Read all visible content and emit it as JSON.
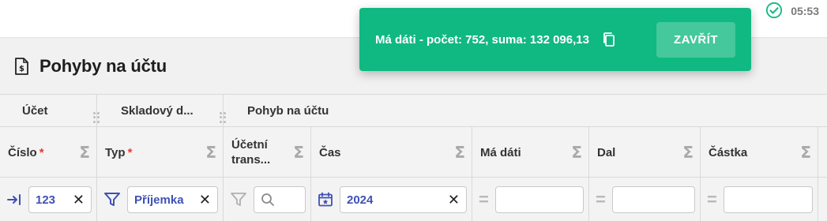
{
  "status": {
    "time": "05:53",
    "check_icon": "check-circle-icon",
    "color": "#10b981"
  },
  "page": {
    "title": "Pohyby na účtu",
    "icon": "document-dollar-icon"
  },
  "groups": [
    {
      "label": "Účet"
    },
    {
      "label": "Skladový d..."
    },
    {
      "label": "Pohyb na účtu"
    }
  ],
  "columns": {
    "cislo": {
      "label": "Číslo",
      "required": "*"
    },
    "typ": {
      "label": "Typ",
      "required": "*"
    },
    "ucetni_line1": "Účetní",
    "ucetni_line2": "trans...",
    "cas": {
      "label": "Čas"
    },
    "ma_dati": {
      "label": "Má dáti"
    },
    "dal": {
      "label": "Dal"
    },
    "castka": {
      "label": "Částka"
    },
    "sum_symbol": "Σ"
  },
  "filters": {
    "cislo": {
      "value": "123",
      "clear": "✕",
      "icon": "arrow-right-to-bar-icon"
    },
    "typ": {
      "value": "Příjemka",
      "clear": "✕",
      "icon": "filter-icon"
    },
    "ucetni": {
      "icon": "filter-outline-icon",
      "search_icon": "search-icon"
    },
    "cas": {
      "value": "2024",
      "clear": "✕",
      "icon": "calendar-icon"
    },
    "ma_dati": {
      "value": "",
      "eq": "="
    },
    "dal": {
      "value": "",
      "eq": "="
    },
    "castka": {
      "value": "",
      "eq": "="
    }
  },
  "toast": {
    "message": "Má dáti - počet: 752, suma: 132 096,13",
    "button": "ZAVŘÍT",
    "copy_icon": "copy-icon",
    "background": "#10b981"
  },
  "colors": {
    "accent": "#3f51b5",
    "required": "#e53935"
  }
}
